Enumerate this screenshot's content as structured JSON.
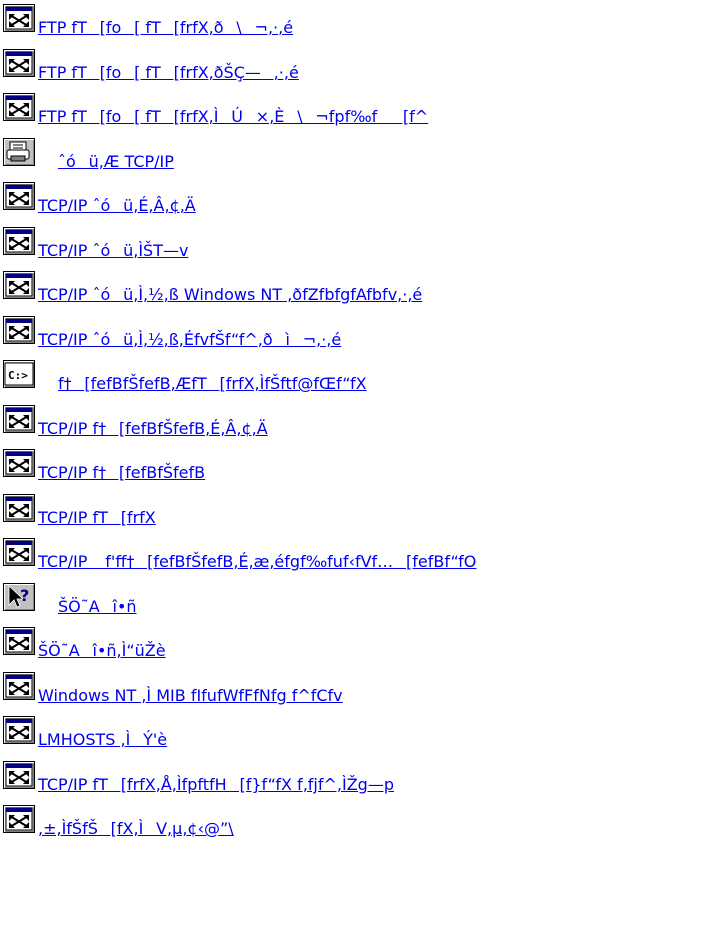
{
  "topics": [
    {
      "label": " FTP fT[fo[ fT[frfX,ð\\¬,·,é",
      "icon": "window-icon",
      "indent": 0
    },
    {
      "label": " FTP fT[fo[ fT[frfX,ðŠÇ—,·,é",
      "icon": "window-icon",
      "indent": 0
    },
    {
      "label": " FTP fT[fo[ fT[frfX,ÌÚ×,È\\¬fpf‰f[f^",
      "icon": "window-icon",
      "indent": 0
    },
    {
      "label": "ˆóü,Æ TCP/IP",
      "icon": "printer-icon",
      "indent": 1
    },
    {
      "label": " TCP/IP ˆóü,É,Â,¢,Ä",
      "icon": "window-icon",
      "indent": 0
    },
    {
      "label": " TCP/IP ˆóü,ÌŠT—v",
      "icon": "window-icon",
      "indent": 0
    },
    {
      "label": " TCP/IP ˆóü,Ì,½,ß Windows NT ,ðfZfbfgfAfbfv,·,é",
      "icon": "window-icon",
      "indent": 0
    },
    {
      "label": " TCP/IP ˆóü,Ì,½,ß,ÉfvfŠf“f^,ðì¬,·,é",
      "icon": "window-icon",
      "indent": 0
    },
    {
      "label": "f†[fefBfŠfefB,ÆfT[frfX,ÌfŠftf@fŒf“fX",
      "icon": "command-prompt-icon",
      "indent": 1
    },
    {
      "label": " TCP/IP f†[fefBfŠfefB,É,Â,¢,Ä",
      "icon": "window-icon",
      "indent": 0
    },
    {
      "label": " TCP/IP f†[fefBfŠfefB",
      "icon": "window-icon",
      "indent": 0
    },
    {
      "label": " TCP/IP fT[frfX",
      "icon": "window-icon",
      "indent": 0
    },
    {
      "label": " TCP/IP f'ff†[fefBfŠfefB,É,æ,éfgf‰fuf‹fVf…[fefBf“fO",
      "icon": "window-icon",
      "indent": 0
    },
    {
      "label": "ŠÖ˜Aî•ñ",
      "icon": "help-pointer-icon",
      "indent": 1
    },
    {
      "label": " ŠÖ˜Aî•ñ,Ì“üŽè",
      "icon": "window-icon",
      "indent": 0
    },
    {
      "label": " Windows NT ,Ì MIB fIfufWfFfNfg f^fCfv",
      "icon": "window-icon",
      "indent": 0
    },
    {
      "label": " LMHOSTS ,ÌÝ'è",
      "icon": "window-icon",
      "indent": 0
    },
    {
      "label": " TCP/IP fT[frfX,Å,ÌfpftfH[f}f“fX f‚fjf^,ÌŽg—p",
      "icon": "window-icon",
      "indent": 0
    },
    {
      "label": " ,±,ÌfŠfŠ[fX,ÌV,µ,¢‹@”\\",
      "icon": "window-icon",
      "indent": 0
    }
  ]
}
